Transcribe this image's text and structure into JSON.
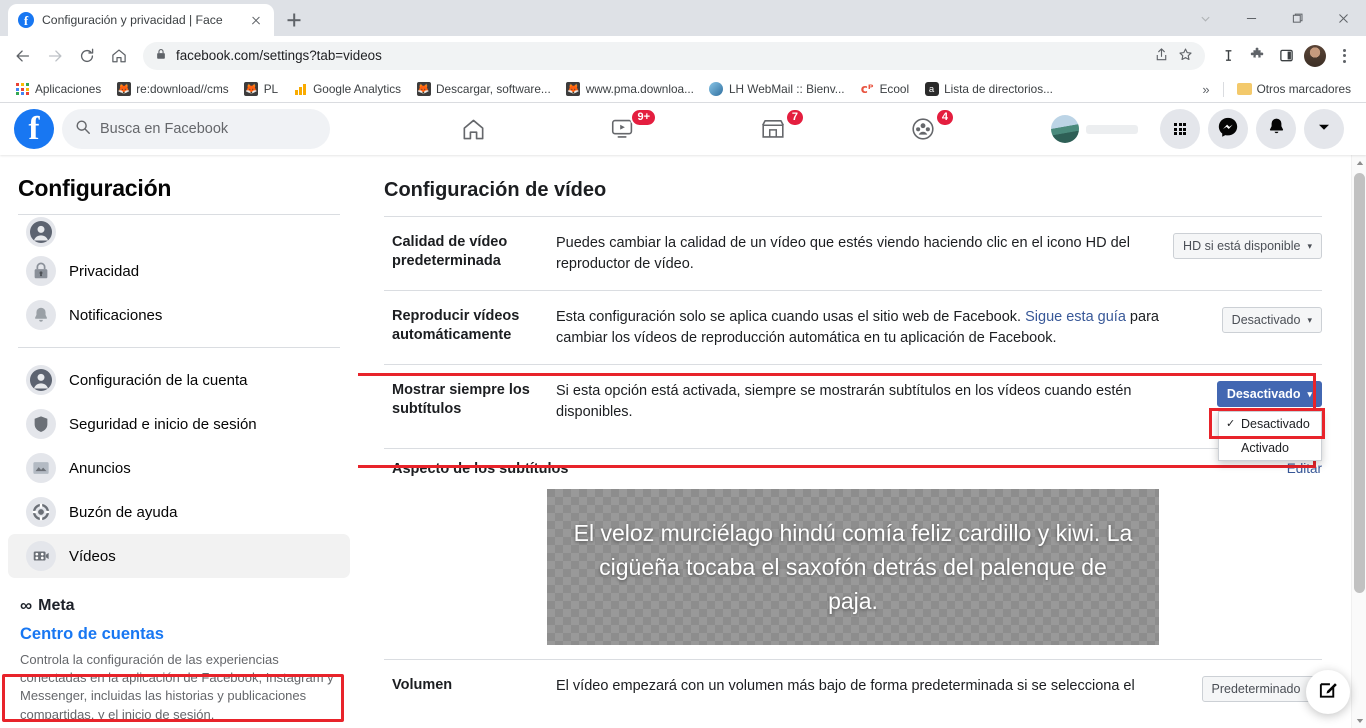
{
  "browser": {
    "tab": {
      "title": "Configuración y privacidad | Face",
      "favicon": "facebook-icon",
      "close": "close-icon"
    },
    "new_tab_label": "+",
    "window_controls": [
      "chevron-down-icon",
      "minimize-icon",
      "maximize-icon",
      "close-icon"
    ],
    "nav": {
      "back": "back-arrow-icon",
      "forward": "forward-arrow-icon",
      "reload": "reload-icon",
      "home": "home-icon"
    },
    "omnibox": {
      "lock": "lock-icon",
      "url": "facebook.com/settings?tab=videos",
      "share": "share-icon",
      "star": "star-icon"
    },
    "toolbar_icons": [
      "reader-mode-icon",
      "extensions-puzzle-icon",
      "sidepanel-icon",
      "profile-avatar-icon",
      "chrome-menu-kebab-icon"
    ],
    "bookmarks": [
      {
        "label": "Aplicaciones",
        "icon": "apps-grid-icon"
      },
      {
        "label": "re:download//cms",
        "icon": "firefox-favicon"
      },
      {
        "label": "PL",
        "icon": "firefox-favicon"
      },
      {
        "label": "Google Analytics",
        "icon": "analytics-bars-icon"
      },
      {
        "label": "Descargar, software...",
        "icon": "firefox-favicon"
      },
      {
        "label": "www.pma.downloa...",
        "icon": "firefox-favicon"
      },
      {
        "label": "LH WebMail :: Bienv...",
        "icon": "globe-icon"
      },
      {
        "label": "Ecool",
        "icon": "ecool-icon"
      },
      {
        "label": "Lista de directorios...",
        "icon": "apache-icon"
      }
    ],
    "bookmarks_overflow": "»",
    "other_bookmarks": {
      "label": "Otros marcadores",
      "icon": "folder-icon"
    }
  },
  "fb_header": {
    "logo": "facebook-logo",
    "search_placeholder": "Busca en Facebook",
    "search_icon": "search-icon",
    "nav_tabs": [
      {
        "name": "home",
        "icon": "home-icon",
        "badge": ""
      },
      {
        "name": "watch",
        "icon": "watch-video-icon",
        "badge": "9+"
      },
      {
        "name": "marketplace",
        "icon": "marketplace-store-icon",
        "badge": "7"
      },
      {
        "name": "groups",
        "icon": "groups-icon",
        "badge": "4"
      }
    ],
    "right_icons": [
      {
        "name": "menu-grid",
        "icon": "apps-grid-icon"
      },
      {
        "name": "messenger",
        "icon": "messenger-icon"
      },
      {
        "name": "notifications",
        "icon": "bell-icon"
      },
      {
        "name": "account",
        "icon": "chevron-down-icon"
      }
    ],
    "profile_avatar": "user-avatar"
  },
  "sidebar": {
    "title": "Configuración",
    "items": [
      {
        "label": "",
        "icon": "profile-icon"
      },
      {
        "label": "Privacidad",
        "icon": "lock-icon"
      },
      {
        "label": "Notificaciones",
        "icon": "bell-icon"
      },
      {
        "label": "Configuración de la cuenta",
        "icon": "profile-icon"
      },
      {
        "label": "Seguridad e inicio de sesión",
        "icon": "shield-icon"
      },
      {
        "label": "Anuncios",
        "icon": "ads-icon"
      },
      {
        "label": "Buzón de ayuda",
        "icon": "support-inbox-icon"
      },
      {
        "label": "Vídeos",
        "icon": "videos-icon"
      }
    ],
    "active_item": "Vídeos",
    "meta": {
      "brand": "Meta",
      "brand_mark": "∞",
      "link": "Centro de cuentas",
      "description": "Controla la configuración de las experiencias conectadas en la aplicación de Facebook, Instagram y Messenger, incluidas las historias y publicaciones compartidas, y el inicio de sesión."
    }
  },
  "main": {
    "title": "Configuración de vídeo",
    "rows": [
      {
        "label": "Calidad de vídeo predeterminada",
        "desc": "Puedes cambiar la calidad de un vídeo que estés viendo haciendo clic en el icono HD del reproductor de vídeo.",
        "control": "HD si está disponible",
        "caret": "▾",
        "style": "default"
      },
      {
        "label": "Reproducir vídeos automáticamente",
        "desc_before": "Esta configuración solo se aplica cuando usas el sitio web de Facebook. ",
        "desc_link": "Sigue esta guía",
        "desc_after": " para cambiar los vídeos de reproducción automática en tu aplicación de Facebook.",
        "control": "Desactivado",
        "caret": "▾",
        "style": "default"
      },
      {
        "label": "Mostrar siempre los subtítulos",
        "desc": "Si esta opción está activada, siempre se mostrarán subtítulos en los vídeos cuando estén disponibles.",
        "control": "Desactivado",
        "caret": "▾",
        "style": "primary",
        "dropdown_open": true,
        "options": [
          {
            "label": "Desactivado",
            "checked": true
          },
          {
            "label": "Activado",
            "checked": false
          }
        ]
      }
    ],
    "subtitle_section": {
      "title": "Aspecto de los subtítulos",
      "edit_label": "Editar",
      "preview_text": "El veloz murciélago hindú comía feliz cardillo y kiwi. La cigüeña tocaba el saxofón detrás del palenque de paja."
    },
    "volume_row": {
      "label": "Volumen",
      "desc": "El vídeo empezará con un volumen más bajo de forma predeterminada si se selecciona el",
      "control": "Predeterminado",
      "caret": "▾"
    },
    "fab": "compose-edit-icon"
  },
  "colors": {
    "accent": "#1877f2",
    "primary_button": "#4267b2",
    "highlight_red": "#e8232a",
    "badge_red": "#e41e3f",
    "link": "#385898"
  }
}
